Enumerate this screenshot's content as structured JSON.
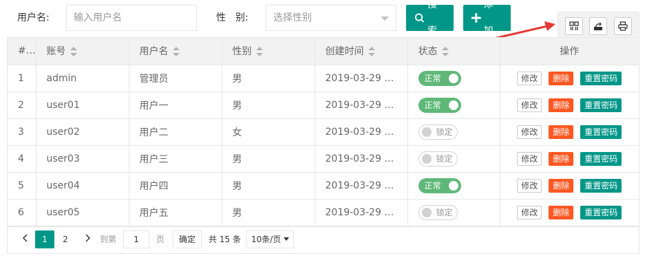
{
  "search": {
    "username_label": "用户名:",
    "username_placeholder": "输入用户名",
    "gender_label": "性　别:",
    "gender_placeholder": "选择性别",
    "search_button": "搜索",
    "add_button": "添加"
  },
  "toolbar": {
    "icons": [
      "columns-icon",
      "export-icon",
      "print-icon"
    ]
  },
  "table": {
    "headers": [
      "#",
      "账号",
      "用户名",
      "性别",
      "创建时间",
      "状态",
      "操作"
    ],
    "rows": [
      {
        "idx": "1",
        "account": "admin",
        "name": "管理员",
        "gender": "男",
        "created": "2019-03-29 1...",
        "status": "正常",
        "on": true
      },
      {
        "idx": "2",
        "account": "user01",
        "name": "用户一",
        "gender": "男",
        "created": "2019-03-29 1...",
        "status": "正常",
        "on": true
      },
      {
        "idx": "3",
        "account": "user02",
        "name": "用户二",
        "gender": "女",
        "created": "2019-03-29 1...",
        "status": "锁定",
        "on": false
      },
      {
        "idx": "4",
        "account": "user03",
        "name": "用户三",
        "gender": "男",
        "created": "2019-03-29 1...",
        "status": "锁定",
        "on": false
      },
      {
        "idx": "5",
        "account": "user04",
        "name": "用户四",
        "gender": "男",
        "created": "2019-03-29 1...",
        "status": "正常",
        "on": true
      },
      {
        "idx": "6",
        "account": "user05",
        "name": "用户五",
        "gender": "男",
        "created": "2019-03-29 1...",
        "status": "锁定",
        "on": false
      }
    ],
    "actions": {
      "edit": "修改",
      "delete": "删除",
      "reset": "重置密码"
    }
  },
  "pager": {
    "pages": [
      "1",
      "2"
    ],
    "current": "1",
    "goto_label": "到第",
    "goto_value": "1",
    "page_unit": "页",
    "confirm": "确定",
    "total": "共 15 条",
    "per_page": "10条/页"
  },
  "colors": {
    "primary": "#009688",
    "danger": "#ff5722",
    "switch_on": "#5fb878",
    "arrow": "#e53935"
  }
}
